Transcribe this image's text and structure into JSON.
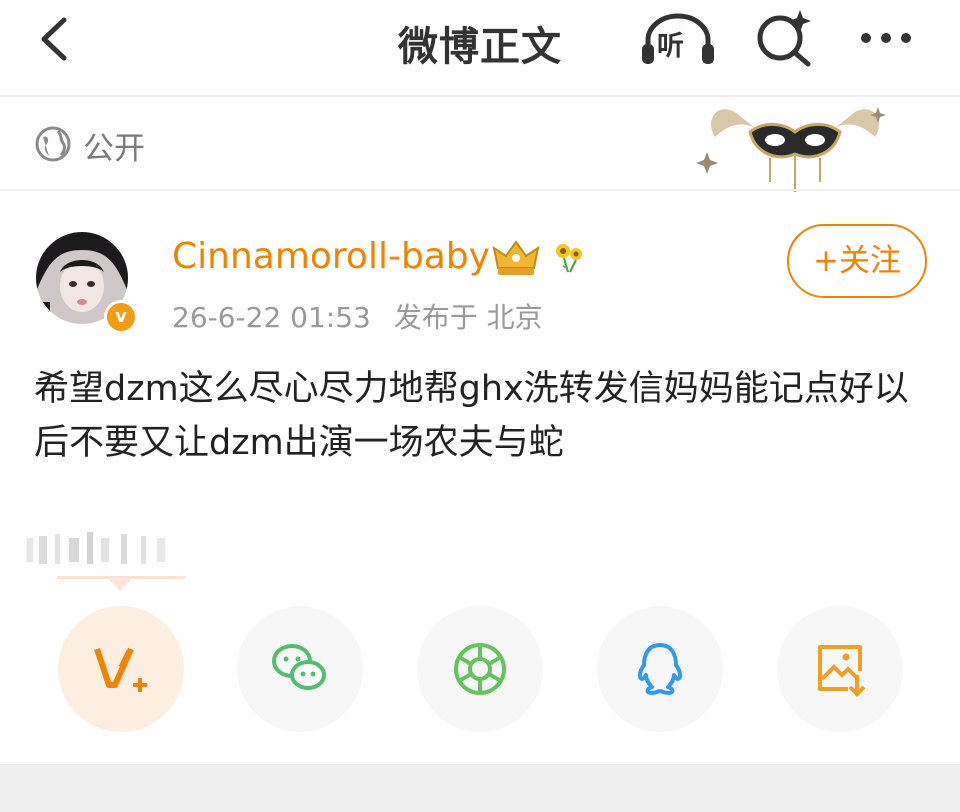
{
  "header": {
    "title": "微博正文",
    "listen_label": "听",
    "back_icon": "chevron-left-icon",
    "search_icon": "search-sparkle-icon",
    "more_icon": "more-dots-icon"
  },
  "visibility": {
    "label": "公开",
    "icon": "globe-icon"
  },
  "post": {
    "username": "Cinnamoroll-baby",
    "verified_badge": "v",
    "timestamp": "26-6-22 01:53",
    "location": "发布于 北京",
    "follow_label": "+关注",
    "text": "希望dzm这么尽心尽力地帮ghx洗转发信妈妈能记点好以后不要又让dzm出演一场农夫与蛇"
  },
  "share_targets": [
    {
      "name": "vlog-icon",
      "color": "#f08300"
    },
    {
      "name": "wechat-icon",
      "color": "#4fbf6e"
    },
    {
      "name": "moments-icon",
      "color": "#62c45a"
    },
    {
      "name": "qq-icon",
      "color": "#2e9af2"
    },
    {
      "name": "save-image-icon",
      "color": "#f0a020"
    }
  ],
  "colors": {
    "accent": "#f08300",
    "muted": "#9a9a9a"
  }
}
